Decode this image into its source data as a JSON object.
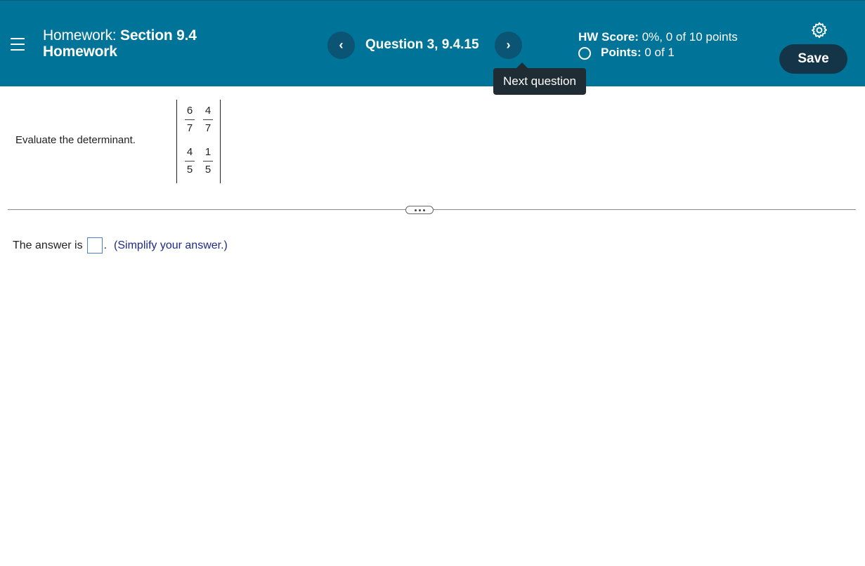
{
  "header": {
    "hw_prefix": "Homework:",
    "hw_section": "Section 9.4",
    "hw_line2": "Homework",
    "question_label": "Question 3, 9.4.15",
    "prev_glyph": "‹",
    "next_glyph": "›",
    "tooltip": "Next question",
    "score_label": "HW Score:",
    "score_value": "0%, 0 of 10 points",
    "points_label": "Points:",
    "points_value": "0 of 1",
    "save_label": "Save",
    "settings_icon": "gear-icon",
    "menu_icon": "hamburger-menu-icon"
  },
  "question": {
    "prompt": "Evaluate the determinant.",
    "matrix": {
      "r1c1_num": "6",
      "r1c1_den": "7",
      "r1c2_num": "4",
      "r1c2_den": "7",
      "r2c1_num": "4",
      "r2c1_den": "5",
      "r2c2_num": "1",
      "r2c2_den": "5"
    }
  },
  "answer": {
    "lead": "The answer is",
    "period": ".",
    "hint": "(Simplify your answer.)",
    "value": ""
  },
  "colors": {
    "header_bg": "#007398",
    "nav_button": "#0c5473",
    "save_button": "#143548",
    "tooltip_bg": "#1f2c33",
    "hint_text": "#1d2a8a"
  }
}
